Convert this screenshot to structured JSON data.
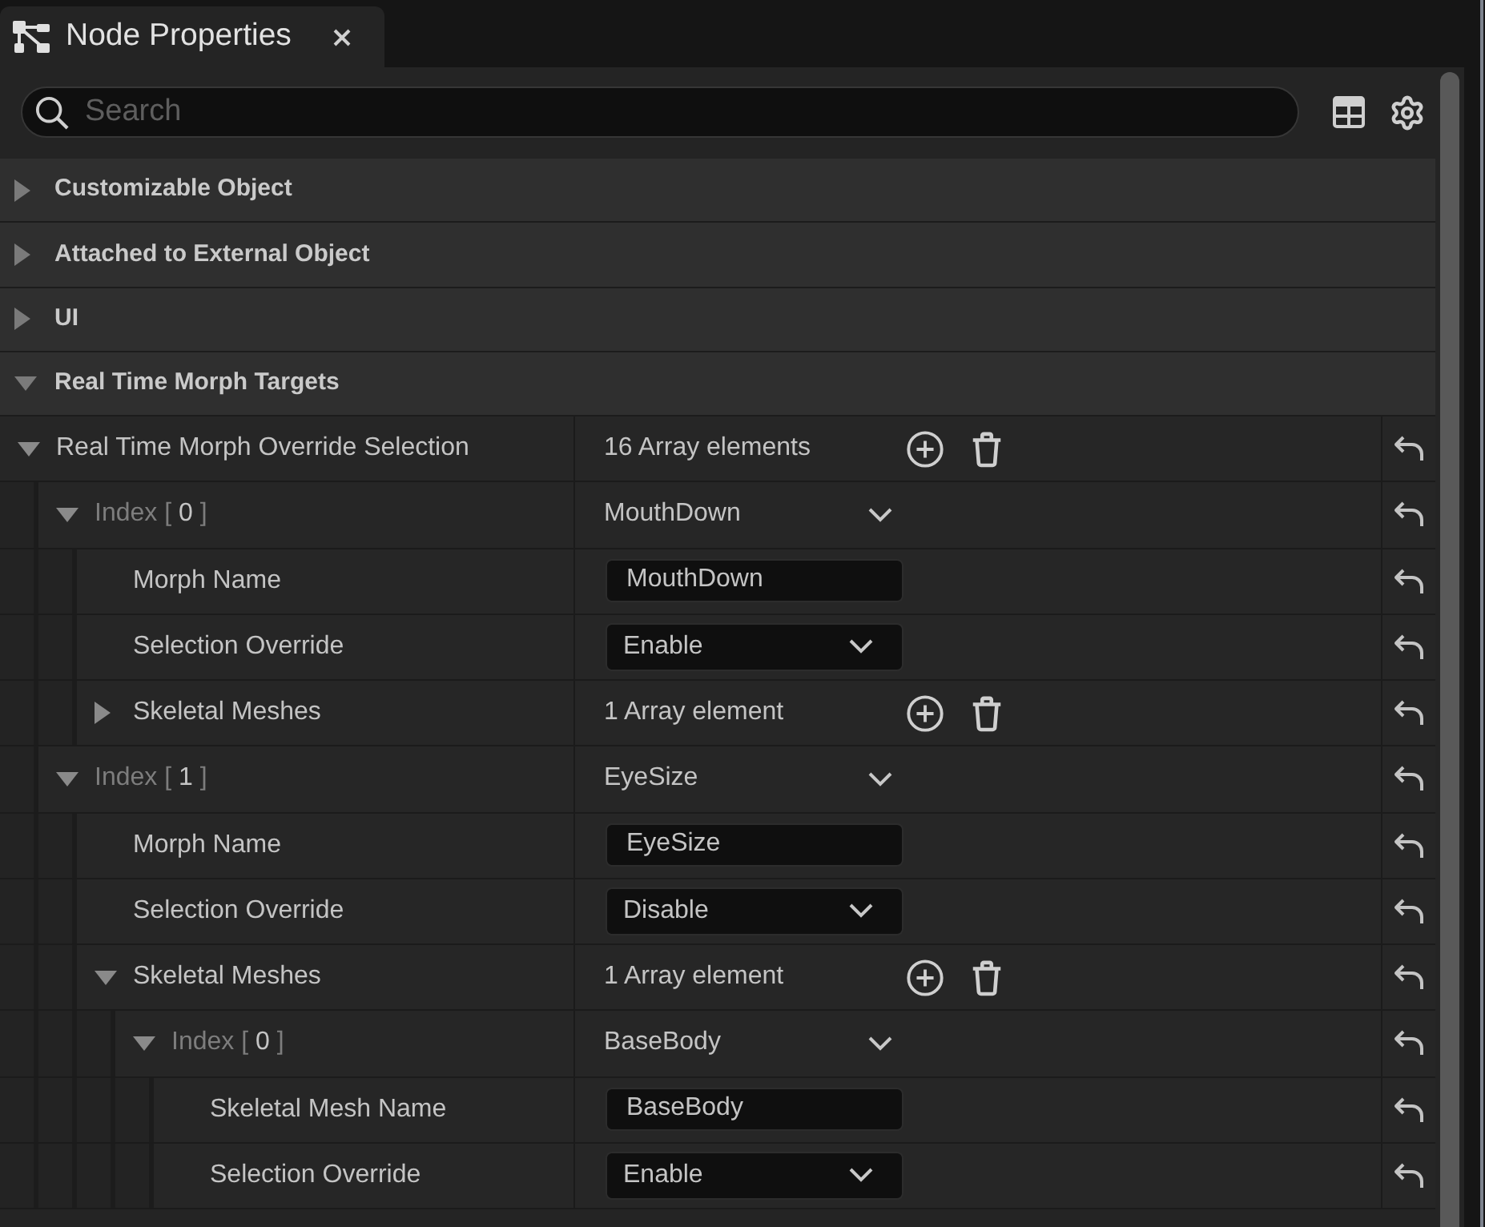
{
  "tabs": [
    {
      "title": "Node Properties",
      "selected": true
    }
  ],
  "search": {
    "placeholder": "Search"
  },
  "categories": [
    {
      "name": "Customizable Object",
      "expanded": false
    },
    {
      "name": "Attached to External Object",
      "expanded": false
    },
    {
      "name": "UI",
      "expanded": false
    },
    {
      "name": "Real Time Morph Targets",
      "expanded": true,
      "properties": [
        {
          "kind": "array",
          "name": "Real Time Morph Override Selection",
          "value": "16 Array elements",
          "expanded": true,
          "children": [
            {
              "kind": "element",
              "name": "Index [ ",
              "index": "0",
              "name_end": " ]",
              "value": "MouthDown",
              "expanded": true,
              "children": [
                {
                  "kind": "text",
                  "name": "Morph Name",
                  "value": "MouthDown"
                },
                {
                  "kind": "combo",
                  "name": "Selection Override",
                  "value": "Enable"
                },
                {
                  "kind": "array",
                  "name": "Skeletal Meshes",
                  "value": "1 Array element",
                  "expanded": false
                }
              ]
            },
            {
              "kind": "element",
              "name": "Index [ ",
              "index": "1",
              "name_end": " ]",
              "value": "EyeSize",
              "expanded": true,
              "children": [
                {
                  "kind": "text",
                  "name": "Morph Name",
                  "value": "EyeSize"
                },
                {
                  "kind": "combo",
                  "name": "Selection Override",
                  "value": "Disable"
                },
                {
                  "kind": "array",
                  "name": "Skeletal Meshes",
                  "value": "1 Array element",
                  "expanded": true,
                  "children": [
                    {
                      "kind": "element",
                      "name": "Index [ ",
                      "index": "0",
                      "name_end": " ]",
                      "value": "BaseBody",
                      "expanded": true,
                      "children": [
                        {
                          "kind": "text",
                          "name": "Skeletal Mesh Name",
                          "value": "BaseBody"
                        },
                        {
                          "kind": "combo",
                          "name": "Selection Override",
                          "value": "Enable"
                        }
                      ]
                    }
                  ]
                }
              ]
            }
          ]
        }
      ]
    }
  ]
}
